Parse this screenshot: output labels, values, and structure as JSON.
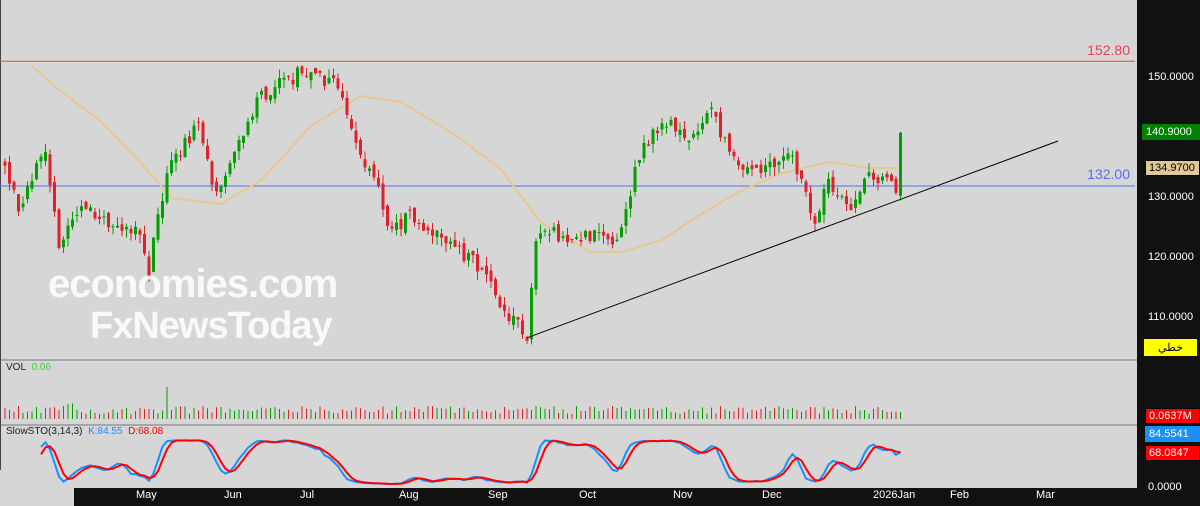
{
  "price_axis": {
    "ticks": [
      "150.0000",
      "130.0000",
      "120.0000",
      "110.0000"
    ],
    "current": "140.9000",
    "ma_value": "134.9700",
    "mode_label": "خطي"
  },
  "levels": {
    "resistance": "152.80",
    "support": "132.00"
  },
  "volume": {
    "title": "VOL",
    "value": "0.06",
    "axis_label": "0.0637M"
  },
  "stochastic": {
    "title": "SlowSTO(3,14,3)",
    "k_label": "K:84.55",
    "d_label": "D:68.08",
    "k_value": "84.5541",
    "d_value": "68.0847",
    "axis_zero": "0.0000"
  },
  "time_axis": [
    "May",
    "Jun",
    "Jul",
    "Aug",
    "Sep",
    "Oct",
    "Nov",
    "Dec",
    "2026Jan",
    "Feb",
    "Mar"
  ],
  "watermark": {
    "line1": "economies.com",
    "line2": "FxNewsToday"
  },
  "colors": {
    "up": "#00a000",
    "down": "#e0202a",
    "ma": "#e8c890",
    "resistance": "#f04050",
    "support": "#5070f0",
    "k": "#1890ff",
    "d": "#ff0000"
  },
  "chart_data": {
    "type": "candlestick",
    "price_range": [
      105,
      155
    ],
    "close_anchors": [
      [
        0,
        136
      ],
      [
        3,
        128
      ],
      [
        9,
        138
      ],
      [
        12,
        122
      ],
      [
        16,
        128
      ],
      [
        21,
        127
      ],
      [
        30,
        124
      ],
      [
        32,
        118
      ],
      [
        36,
        135
      ],
      [
        43,
        142
      ],
      [
        47,
        130
      ],
      [
        52,
        140
      ],
      [
        57,
        147
      ],
      [
        66,
        151
      ],
      [
        74,
        149
      ],
      [
        79,
        138
      ],
      [
        83,
        131
      ],
      [
        86,
        124
      ],
      [
        90,
        127
      ],
      [
        97,
        124
      ],
      [
        106,
        118
      ],
      [
        110,
        112
      ],
      [
        116,
        107
      ],
      [
        118,
        124
      ],
      [
        122,
        124
      ],
      [
        126,
        122
      ],
      [
        132,
        125
      ],
      [
        136,
        123
      ],
      [
        141,
        137
      ],
      [
        146,
        143
      ],
      [
        154,
        140
      ],
      [
        157,
        145
      ],
      [
        161,
        137
      ],
      [
        168,
        134
      ],
      [
        174,
        138
      ],
      [
        180,
        126
      ],
      [
        183,
        133
      ],
      [
        188,
        128
      ],
      [
        192,
        134
      ],
      [
        198,
        132
      ],
      [
        199,
        140.9
      ]
    ],
    "ma_anchors": [
      [
        6,
        152
      ],
      [
        12,
        148
      ],
      [
        21,
        143
      ],
      [
        30,
        136
      ],
      [
        37,
        130
      ],
      [
        48,
        129
      ],
      [
        57,
        133
      ],
      [
        68,
        142
      ],
      [
        79,
        147
      ],
      [
        88,
        146
      ],
      [
        99,
        141
      ],
      [
        110,
        135
      ],
      [
        119,
        126
      ],
      [
        130,
        121
      ],
      [
        137,
        121
      ],
      [
        146,
        123
      ],
      [
        154,
        127
      ],
      [
        163,
        131
      ],
      [
        172,
        134
      ],
      [
        183,
        136
      ],
      [
        192,
        135
      ],
      [
        199,
        135
      ]
    ],
    "trendline": [
      [
        116,
        106.7
      ],
      [
        234,
        139.5
      ]
    ],
    "horizontal_lines": [
      152.8,
      132.0
    ]
  }
}
